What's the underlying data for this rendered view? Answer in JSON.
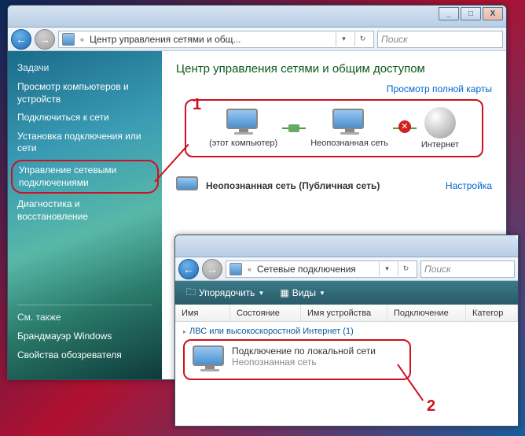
{
  "window1": {
    "titlebar": {
      "min": "_",
      "max": "□",
      "close": "X"
    },
    "nav": {
      "back": "←",
      "fwd": "→"
    },
    "address": {
      "prefix": "«",
      "text": "Центр управления сетями и общ...",
      "dropdown": "▾",
      "refresh": "↻"
    },
    "search": {
      "placeholder": "Поиск"
    }
  },
  "sidebar": {
    "heading": "Задачи",
    "links": [
      "Просмотр компьютеров и устройств",
      "Подключиться к сети",
      "Установка подключения или сети",
      "Управление сетевыми подключениями",
      "Диагностика и восстановление"
    ],
    "footer_heading": "См. также",
    "footer_links": [
      "Брандмауэр Windows",
      "Свойства обозревателя"
    ]
  },
  "content": {
    "title": "Центр управления сетями и общим доступом",
    "map_link": "Просмотр полной карты",
    "nodes": {
      "pc": "(этот компьютер)",
      "net": "Неопознанная сеть",
      "inet": "Интернет"
    },
    "status_label": "Неопознанная сеть (Публичная сеть)",
    "status_action": "Настройка"
  },
  "annotations": {
    "a1": "1",
    "a2": "2"
  },
  "window2": {
    "address": {
      "prefix": "«",
      "text": "Сетевые подключения",
      "dropdown": "▾",
      "refresh": "↻"
    },
    "search": {
      "placeholder": "Поиск"
    },
    "toolbar": {
      "organize": "Упорядочить",
      "views": "Виды"
    },
    "columns": [
      "Имя",
      "Состояние",
      "Имя устройства",
      "Подключение",
      "Категор"
    ],
    "group": "ЛВС или высокоскоростной Интернет (1)",
    "item": {
      "title": "Подключение по локальной сети",
      "sub": "Неопознанная сеть"
    }
  }
}
